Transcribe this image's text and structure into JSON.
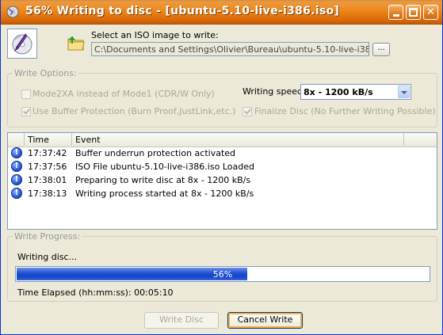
{
  "window": {
    "title": "56% Writing to disc - [ubuntu-5.10-live-i386.iso]",
    "accent_color": "#e3780f"
  },
  "source": {
    "label": "Select an ISO image to write:",
    "path": "C:\\Documents and Settings\\Olivier\\Bureau\\ubuntu-5.10-live-i386.iso",
    "browse_label": "..."
  },
  "write_options": {
    "legend": "Write Options:",
    "mode2xa_label": "Mode2XA instead of Mode1 (CDR/W Only)",
    "mode2xa_checked": false,
    "buffer_protection_label": "Use Buffer Protection (Burn Proof,JustLink,etc.)",
    "buffer_protection_checked": true,
    "speed_label": "Writing speed:",
    "speed_value": "8x - 1200 kB/s",
    "finalize_label": "Finalize Disc (No Further Writing Possible)",
    "finalize_checked": true
  },
  "log": {
    "columns": [
      "Time",
      "Event"
    ],
    "rows": [
      {
        "time": "17:37:42",
        "event": "Buffer underrun protection activated",
        "icon": "info-icon"
      },
      {
        "time": "17:37:56",
        "event": "ISO File ubuntu-5.10-live-i386.iso Loaded",
        "icon": "info-icon"
      },
      {
        "time": "17:38:01",
        "event": "Preparing to write disc at 8x - 1200 kB/s",
        "icon": "info-icon"
      },
      {
        "time": "17:38:13",
        "event": "Writing process started at 8x - 1200 kB/s",
        "icon": "info-icon"
      }
    ]
  },
  "progress": {
    "legend": "Write Progress:",
    "status": "Writing disc...",
    "percent": 56,
    "percent_label": "56%",
    "elapsed": "Time Elapsed (hh:mm:ss): 00:05:10",
    "fill_color": "#1c4fd0"
  },
  "buttons": {
    "write_label": "Write Disc",
    "cancel_label": "Cancel Write"
  }
}
